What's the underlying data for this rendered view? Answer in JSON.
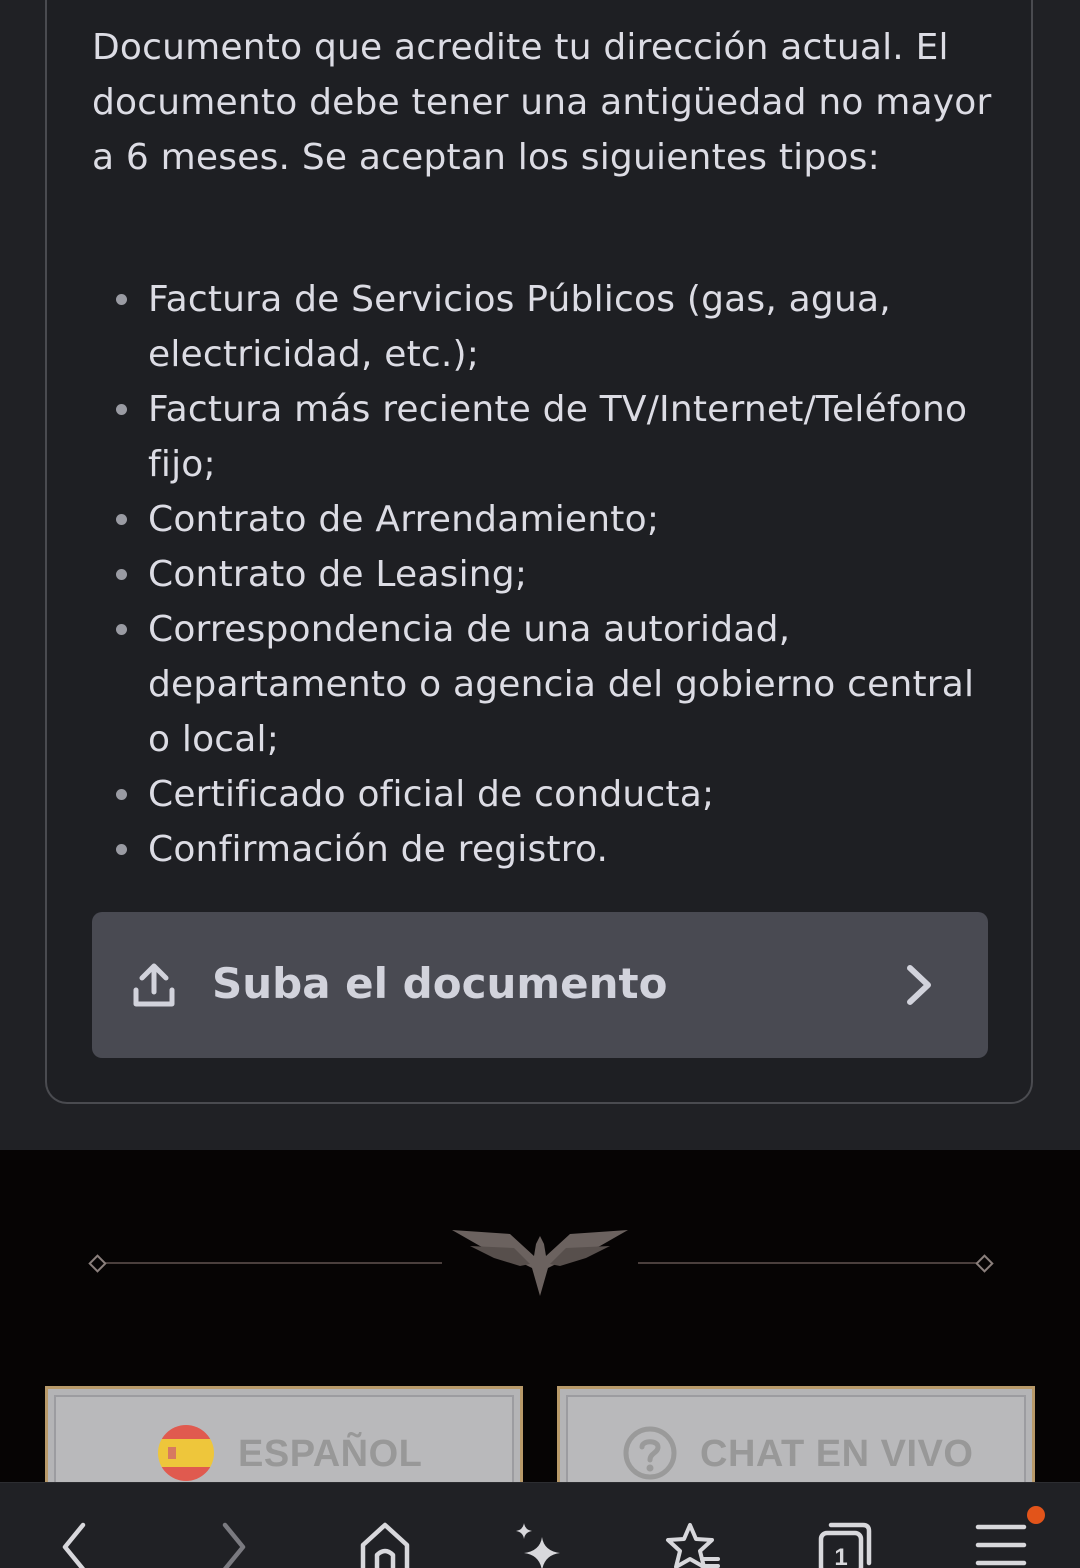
{
  "document_section": {
    "description": "Documento que acredite tu dirección actual. El documento debe tener una antigüedad no mayor a 6 meses. Se aceptan los siguientes tipos:",
    "accepted_types": [
      "Factura de Servicios Públicos (gas, agua, electricidad, etc.);",
      "Factura más reciente de TV/Internet/Teléfono fijo;",
      "Contrato de Arrendamiento;",
      "Contrato de Leasing;",
      "Correspondencia de una autoridad, departamento o agencia del gobierno central o local;",
      "Certificado oficial de conducta;",
      "Confirmación de registro."
    ],
    "upload_button": {
      "label": "Suba el documento",
      "icon": "upload-icon"
    }
  },
  "footer": {
    "language_button": {
      "label": "ESPAÑOL",
      "icon": "spain-flag-icon"
    },
    "chat_button": {
      "label": "CHAT EN VIVO",
      "icon": "help-circle-icon"
    }
  },
  "browser_toolbar": {
    "tab_count": "1",
    "items": [
      "back-icon",
      "forward-icon",
      "home-icon",
      "ai-sparkle-icon",
      "bookmarks-icon",
      "tabs-icon",
      "menu-icon"
    ],
    "notification_color": "#e2541a"
  },
  "colors": {
    "background": "#202125",
    "upload_button_bg": "#494a52",
    "footer_bg": "#060404",
    "footer_button_border": "#b89a6a"
  }
}
